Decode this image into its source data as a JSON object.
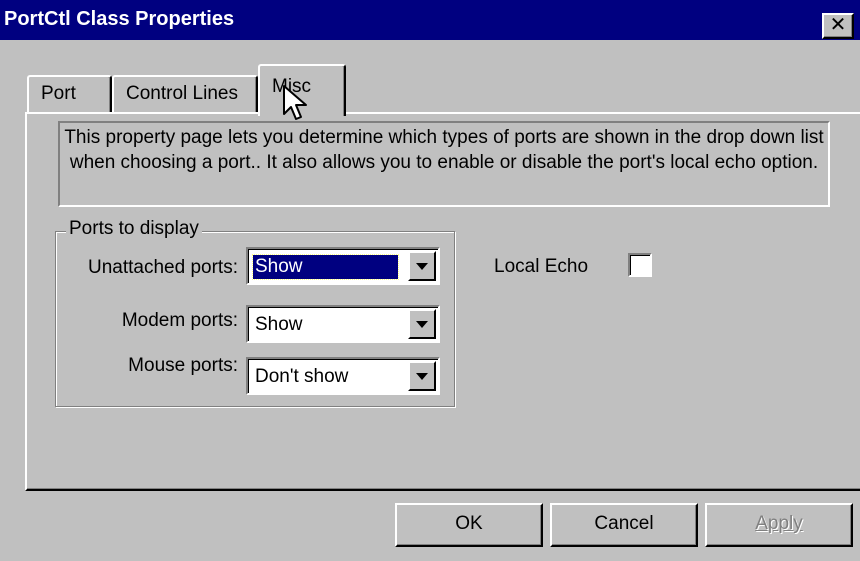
{
  "window": {
    "title": "PortCtl Class Properties",
    "close_glyph": "✕"
  },
  "tabs": [
    {
      "label": "Port"
    },
    {
      "label": "Control Lines"
    },
    {
      "label": "Misc",
      "active": true
    }
  ],
  "description": "This property page lets you determine which types of ports are shown in the drop down list when choosing a port..  It also allows you to enable or disable the port's local echo option.",
  "ports_group": {
    "label": "Ports to display",
    "rows": [
      {
        "label": "Unattached ports:",
        "value": "Show"
      },
      {
        "label": "Modem ports:",
        "value": "Show"
      },
      {
        "label": "Mouse ports:",
        "value": "Don't show"
      }
    ]
  },
  "local_echo": {
    "label": "Local Echo",
    "checked": false
  },
  "buttons": {
    "ok": "OK",
    "cancel": "Cancel",
    "apply": "Apply"
  },
  "colors": {
    "titlebar": "#000080",
    "face": "#c0c0c0",
    "selection": "#000080"
  }
}
